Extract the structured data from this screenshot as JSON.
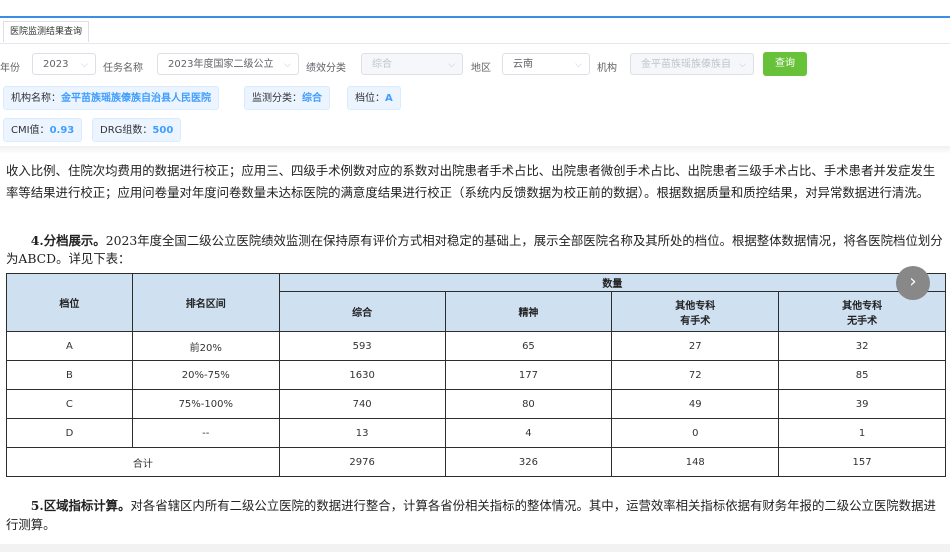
{
  "tab": {
    "label": "医院监测结果查询"
  },
  "filters": {
    "year_label": "年份",
    "year_value": "2023",
    "task_label": "任务名称",
    "task_value": "2023年度国家二级公立",
    "perf_label": "绩效分类",
    "perf_value": "综合",
    "region_label": "地区",
    "region_value": "云南",
    "org_label": "机构",
    "org_value": "金平苗族瑶族傣族自",
    "query_button": "查询"
  },
  "info": {
    "org_name_label": "机构名称：",
    "org_name_value": "金平苗族瑶族傣族自治县人民医院",
    "monitor_label": "监测分类：",
    "monitor_value": "综合",
    "level_label": "档位：",
    "level_value": "A",
    "cmi_label": "CMI值：",
    "cmi_value": "0.93",
    "drg_label": "DRG组数：",
    "drg_value": "500"
  },
  "document": {
    "para1": "收入比例、住院次均费用的数据进行校正；应用三、四级手术例数对应的系数对出院患者手术占比、出院患者微创手术占比、出院患者三级手术占比、手术患者并发症发生率等结果进行校正；应用问卷量对年度问卷数量未达标医院的满意度结果进行校正（系统内反馈数据为校正前的数据）。根据数据质量和质控结果，对异常数据进行清洗。",
    "para2_title": "4.分档展示。",
    "para2_body": "2023年度全国二级公立医院绩效监测在保持原有评价方式相对稳定的基础上，展示全部医院名称及其所处的档位。根据整体数据情况，将各医院档位划分为ABCD。详见下表：",
    "para3_title": "5.区域指标计算。",
    "para3_body": "对各省辖区内所有二级公立医院的数据进行整合，计算各省份相关指标的整体情况。其中，运营效率相关指标依据有财务年报的二级公立医院数据进行测算。"
  },
  "table": {
    "head_level": "档位",
    "head_rank": "排名区间",
    "head_qty": "数量",
    "head_comp": "综合",
    "head_mental": "精神",
    "head_spec_surg_1": "其他专科",
    "head_spec_surg_2": "有手术",
    "head_spec_nosurg_1": "其他专科",
    "head_spec_nosurg_2": "无手术",
    "rows": [
      {
        "level": "A",
        "range": "前20%",
        "comp": "593",
        "mental": "65",
        "surg": "27",
        "nosurg": "32"
      },
      {
        "level": "B",
        "range": "20%-75%",
        "comp": "1630",
        "mental": "177",
        "surg": "72",
        "nosurg": "85"
      },
      {
        "level": "C",
        "range": "75%-100%",
        "comp": "740",
        "mental": "80",
        "surg": "49",
        "nosurg": "39"
      },
      {
        "level": "D",
        "range": "--",
        "comp": "13",
        "mental": "4",
        "surg": "0",
        "nosurg": "1"
      }
    ],
    "total": {
      "label": "合计",
      "comp": "2976",
      "mental": "326",
      "surg": "148",
      "nosurg": "157"
    }
  },
  "icons": {
    "next": "chevron-right-icon",
    "dropdown": "chevron-down-icon"
  },
  "colors": {
    "accent": "#409eff",
    "query": "#67c23a",
    "table_head": "#cfe0f1"
  }
}
